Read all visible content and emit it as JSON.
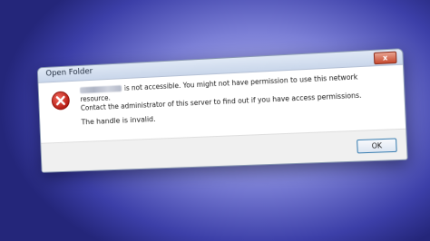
{
  "dialog": {
    "title": "Open Folder",
    "close_label": "x",
    "icon": "error-icon",
    "message_line1": "is not accessible. You might not have permission to use this network resource.",
    "message_line2": "Contact the administrator of this server to find out if you have access permissions.",
    "detail": "The handle is invalid.",
    "ok_label": "OK"
  },
  "colors": {
    "error_red": "#d9261c",
    "background_blue": "#5a5ec4"
  }
}
